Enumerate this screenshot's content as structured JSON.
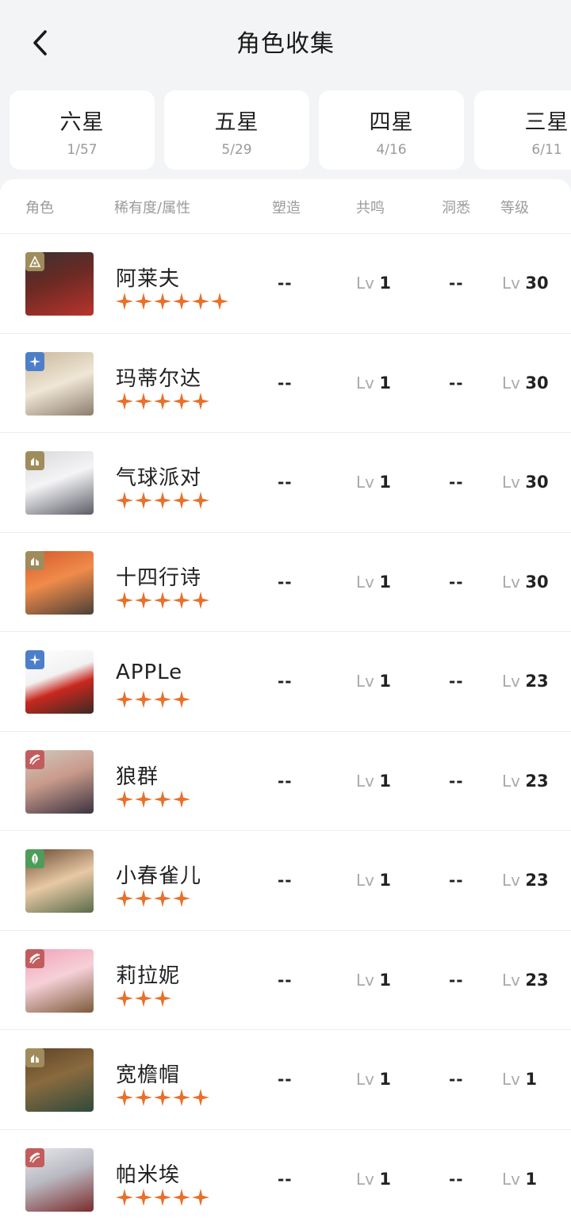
{
  "header": {
    "title": "角色收集"
  },
  "tabs": [
    {
      "label": "六星",
      "count": "1/57"
    },
    {
      "label": "五星",
      "count": "5/29"
    },
    {
      "label": "四星",
      "count": "4/16"
    },
    {
      "label": "三星",
      "count": "6/11"
    }
  ],
  "columns": {
    "role": "角色",
    "rarity_attr": "稀有度/属性",
    "craft": "塑造",
    "resonance": "共鸣",
    "insight": "洞悉",
    "level": "等级"
  },
  "colors": {
    "star": "#e8702a",
    "attr_star": "#a08c5b",
    "attr_beast": "#a08c5b",
    "attr_mineral": "#a08c5b",
    "attr_spirit": "#4d7fc8",
    "attr_intellect": "#c25d5d",
    "attr_plant": "#4e9c59"
  },
  "rows": [
    {
      "name": "阿莱夫",
      "stars": 6,
      "attribute": "beast-icon",
      "craft": "--",
      "resonance_prefix": "Lv",
      "resonance": "1",
      "insight": "--",
      "level_prefix": "Lv",
      "level": "30"
    },
    {
      "name": "玛蒂尔达",
      "stars": 5,
      "attribute": "spirit-icon",
      "craft": "--",
      "resonance_prefix": "Lv",
      "resonance": "1",
      "insight": "--",
      "level_prefix": "Lv",
      "level": "30"
    },
    {
      "name": "气球派对",
      "stars": 5,
      "attribute": "mineral-icon",
      "craft": "--",
      "resonance_prefix": "Lv",
      "resonance": "1",
      "insight": "--",
      "level_prefix": "Lv",
      "level": "30"
    },
    {
      "name": "十四行诗",
      "stars": 5,
      "attribute": "mineral-icon",
      "craft": "--",
      "resonance_prefix": "Lv",
      "resonance": "1",
      "insight": "--",
      "level_prefix": "Lv",
      "level": "30"
    },
    {
      "name": "APPLe",
      "stars": 4,
      "attribute": "spirit-icon",
      "craft": "--",
      "resonance_prefix": "Lv",
      "resonance": "1",
      "insight": "--",
      "level_prefix": "Lv",
      "level": "23"
    },
    {
      "name": "狼群",
      "stars": 4,
      "attribute": "intellect-icon",
      "craft": "--",
      "resonance_prefix": "Lv",
      "resonance": "1",
      "insight": "--",
      "level_prefix": "Lv",
      "level": "23"
    },
    {
      "name": "小春雀儿",
      "stars": 4,
      "attribute": "plant-icon",
      "craft": "--",
      "resonance_prefix": "Lv",
      "resonance": "1",
      "insight": "--",
      "level_prefix": "Lv",
      "level": "23"
    },
    {
      "name": "莉拉妮",
      "stars": 3,
      "attribute": "intellect-icon",
      "craft": "--",
      "resonance_prefix": "Lv",
      "resonance": "1",
      "insight": "--",
      "level_prefix": "Lv",
      "level": "23"
    },
    {
      "name": "宽檐帽",
      "stars": 5,
      "attribute": "mineral-icon",
      "craft": "--",
      "resonance_prefix": "Lv",
      "resonance": "1",
      "insight": "--",
      "level_prefix": "Lv",
      "level": "1"
    },
    {
      "name": "帕米埃",
      "stars": 5,
      "attribute": "intellect-icon",
      "craft": "--",
      "resonance_prefix": "Lv",
      "resonance": "1",
      "insight": "--",
      "level_prefix": "Lv",
      "level": "1"
    }
  ]
}
